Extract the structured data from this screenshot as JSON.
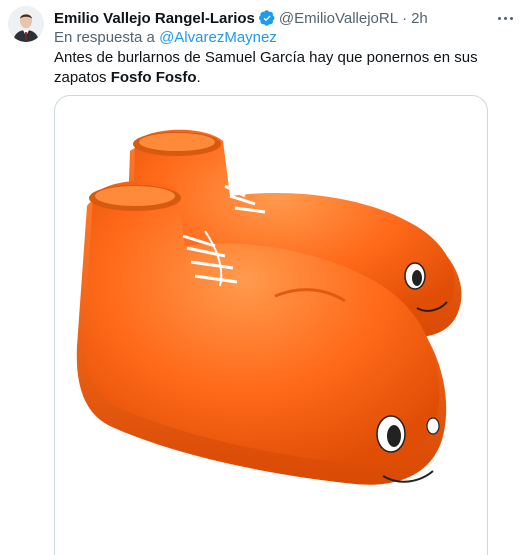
{
  "tweet": {
    "author_name": "Emilio Vallejo Rangel-Larios",
    "author_handle": "@EmilioVallejoRL",
    "separator": "·",
    "time": "2h",
    "reply_prefix": "En respuesta a",
    "reply_to": "@AlvarezMaynez",
    "text_main": "Antes de burlarnos de Samuel García hay que ponernos en sus zapatos ",
    "text_bold": "Fosfo Fosfo",
    "text_end": ".",
    "verified_color": "#1d9bf0",
    "link_color": "#1d9bf0"
  },
  "media": {
    "icon": "clown-shoes-image",
    "shoe_color": "#ff6a1a"
  }
}
